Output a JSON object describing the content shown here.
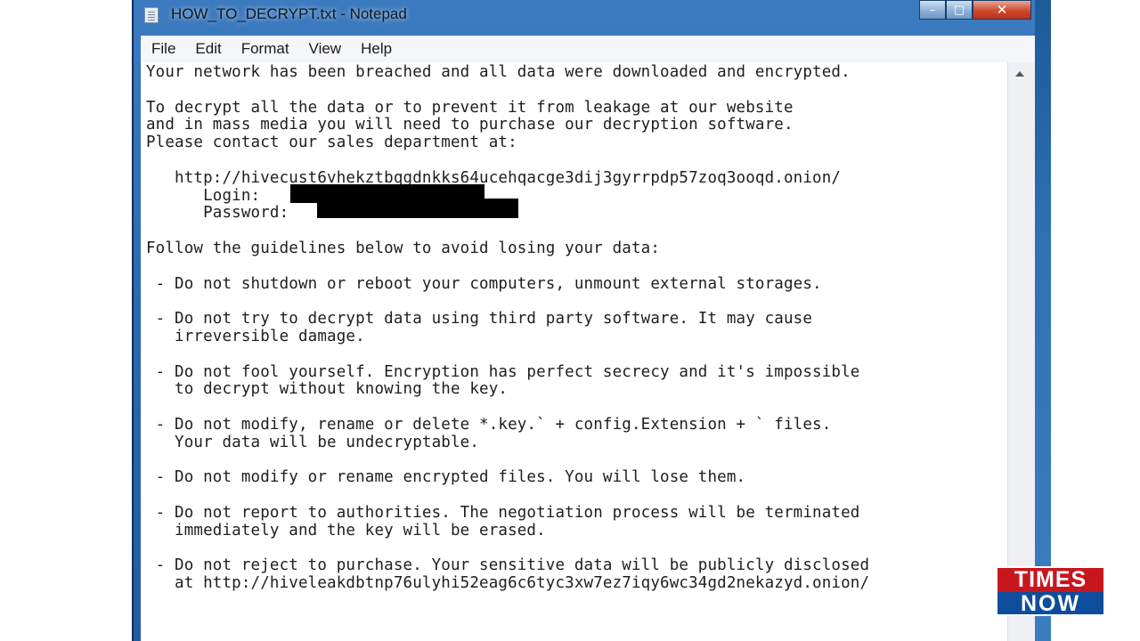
{
  "window": {
    "title": "HOW_TO_DECRYPT.txt - Notepad",
    "minimize_glyph": "–",
    "maximize_glyph": "□",
    "close_glyph": "✕"
  },
  "menu": [
    "File",
    "Edit",
    "Format",
    "View",
    "Help"
  ],
  "document": {
    "lines": [
      "Your network has been breached and all data were downloaded and encrypted.",
      "",
      "To decrypt all the data or to prevent it from leakage at our website",
      "and in mass media you will need to purchase our decryption software.",
      "Please contact our sales department at:",
      "",
      "   http://hivecust6vhekztbqgdnkks64ucehqacge3dij3gyrrpdp57zoq3ooqd.onion/",
      "      Login:",
      "      Password:",
      "",
      "Follow the guidelines below to avoid losing your data:",
      "",
      " - Do not shutdown or reboot your computers, unmount external storages.",
      "",
      " - Do not try to decrypt data using third party software. It may cause",
      "   irreversible damage.",
      "",
      " - Do not fool yourself. Encryption has perfect secrecy and it's impossible",
      "   to decrypt without knowing the key.",
      "",
      " - Do not modify, rename or delete *.key.` + config.Extension + ` files.",
      "   Your data will be undecryptable.",
      "",
      " - Do not modify or rename encrypted files. You will lose them.",
      "",
      " - Do not report to authorities. The negotiation process will be terminated",
      "   immediately and the key will be erased.",
      "",
      " - Do not reject to purchase. Your sensitive data will be publicly disclosed",
      "   at http://hiveleakdbtnp76ulyhi52eag6c6tyc3xw7ez7iqy6wc34gd2nekazyd.onion/"
    ]
  },
  "logo": {
    "top": "TIMES",
    "bottom": "NOW"
  },
  "colors": {
    "titlebar": "#2d69ad",
    "close_button": "#d0492c",
    "logo_red": "#c8161d",
    "logo_blue": "#0e4d9b"
  }
}
